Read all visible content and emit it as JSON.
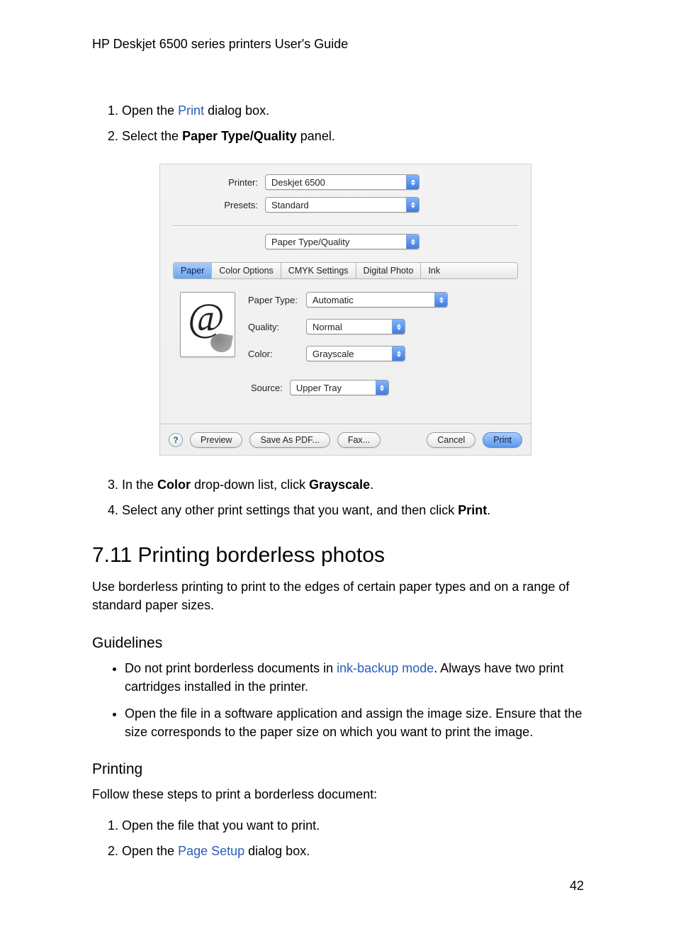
{
  "header": "HP Deskjet 6500 series printers User's Guide",
  "steps_a": {
    "s1_a": "Open the ",
    "s1_link": "Print",
    "s1_b": " dialog box.",
    "s2_a": "Select the ",
    "s2_bold": "Paper Type/Quality",
    "s2_b": " panel."
  },
  "dlg": {
    "printer_label": "Printer:",
    "printer_value": "Deskjet 6500",
    "presets_label": "Presets:",
    "presets_value": "Standard",
    "pane_value": "Paper Type/Quality",
    "tabs": [
      "Paper",
      "Color Options",
      "CMYK Settings",
      "Digital Photo",
      "Ink"
    ],
    "papertype_label": "Paper Type:",
    "papertype_value": "Automatic",
    "quality_label": "Quality:",
    "quality_value": "Normal",
    "color_label": "Color:",
    "color_value": "Grayscale",
    "source_label": "Source:",
    "source_value": "Upper Tray",
    "help": "?",
    "preview": "Preview",
    "savepdf": "Save As PDF...",
    "fax": "Fax...",
    "cancel": "Cancel",
    "print": "Print"
  },
  "steps_b": {
    "s3_a": "In the ",
    "s3_bold1": "Color",
    "s3_b": " drop-down list, click ",
    "s3_bold2": "Grayscale",
    "s3_c": ".",
    "s4_a": "Select any other print settings that you want, and then click ",
    "s4_bold": "Print",
    "s4_b": "."
  },
  "section": {
    "title": "7.11  Printing borderless photos",
    "intro": "Use borderless printing to print to the edges of certain paper types and on a range of standard paper sizes.",
    "guidelines_h": "Guidelines",
    "g1_a": "Do not print borderless documents in ",
    "g1_link": "ink-backup mode",
    "g1_b": ". Always have two print cartridges installed in the printer.",
    "g2": "Open the file in a software application and assign the image size. Ensure that the size corresponds to the paper size on which you want to print the image.",
    "printing_h": "Printing",
    "printing_intro": "Follow these steps to print a borderless document:",
    "p1": "Open the file that you want to print.",
    "p2_a": "Open the ",
    "p2_link": "Page Setup",
    "p2_b": " dialog box."
  },
  "pagenum": "42"
}
